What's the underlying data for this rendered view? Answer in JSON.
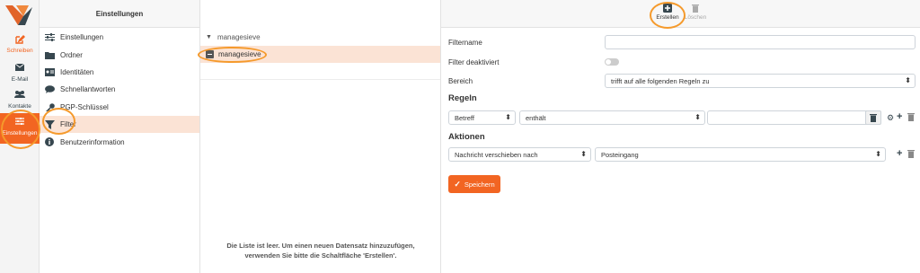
{
  "appbar": {
    "items": [
      {
        "label": "Schreiben",
        "icon": "compose-icon"
      },
      {
        "label": "E-Mail",
        "icon": "mail-icon"
      },
      {
        "label": "Kontakte",
        "icon": "contacts-icon"
      },
      {
        "label": "Einstellungen",
        "icon": "sliders-icon"
      }
    ],
    "accent": "#f26522"
  },
  "settings": {
    "title": "Einstellungen",
    "items": [
      {
        "label": "Einstellungen",
        "icon": "sliders-icon"
      },
      {
        "label": "Ordner",
        "icon": "folder-icon"
      },
      {
        "label": "Identitäten",
        "icon": "id-card-icon"
      },
      {
        "label": "Schnellantworten",
        "icon": "speech-bubble-icon"
      },
      {
        "label": "PGP-Schlüssel",
        "icon": "key-icon"
      },
      {
        "label": "Filter",
        "icon": "filter-icon"
      },
      {
        "label": "Benutzerinformation",
        "icon": "info-icon"
      }
    ]
  },
  "list": {
    "group": "managesieve",
    "selected": "managesieve",
    "empty_line1": "Die Liste ist leer. Um einen neuen Datensatz hinzuzufügen,",
    "empty_line2": "verwenden Sie bitte die Schaltfläche 'Erstellen'."
  },
  "toolbar": {
    "create": "Erstellen",
    "delete": "Löschen"
  },
  "form": {
    "filtername_label": "Filtername",
    "filtername_value": "",
    "disabled_label": "Filter deaktiviert",
    "scope_label": "Bereich",
    "scope_value": "trifft auf alle folgenden Regeln zu",
    "rules_title": "Regeln",
    "rule_header": "Betreff",
    "rule_op": "enthält",
    "rule_value": "",
    "actions_title": "Aktionen",
    "action_type": "Nachricht verschieben nach",
    "action_target": "Posteingang",
    "save": "Speichern"
  }
}
